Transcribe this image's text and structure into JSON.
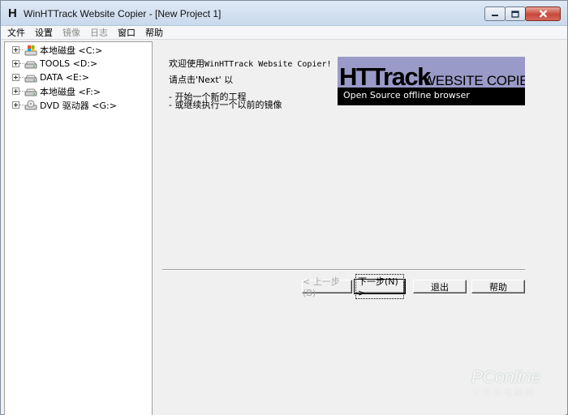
{
  "window": {
    "logo_letter": "H",
    "title": "WinHTTrack Website Copier - [New Project 1]"
  },
  "menubar": {
    "items": [
      {
        "label": "文件",
        "enabled": true
      },
      {
        "label": "设置",
        "enabled": true
      },
      {
        "label": "镜像",
        "enabled": false
      },
      {
        "label": "日志",
        "enabled": false
      },
      {
        "label": "窗口",
        "enabled": true
      },
      {
        "label": "帮助",
        "enabled": true
      }
    ]
  },
  "tree": {
    "items": [
      {
        "label": "本地磁盘 <C:>",
        "icon": "system-drive-icon"
      },
      {
        "label": "TOOLS <D:>",
        "icon": "hard-drive-icon"
      },
      {
        "label": "DATA <E:>",
        "icon": "hard-drive-icon"
      },
      {
        "label": "本地磁盘 <F:>",
        "icon": "hard-drive-icon"
      },
      {
        "label": "DVD 驱动器 <G:>",
        "icon": "dvd-drive-icon"
      }
    ]
  },
  "content": {
    "welcome_prefix": "欢迎使用",
    "welcome_app": "WinHTTrack Website Copier!",
    "prompt": "请点击'Next' 以",
    "option_new": "- 开始一个新的工程",
    "option_continue": "- 或继续执行一个以前的镜像",
    "logo": {
      "big": "HTTrack",
      "small": "WEBSITE COPIER",
      "tagline": "Open Source offline browser",
      "bg_color": "#9a9ac8"
    }
  },
  "buttons": {
    "back": "< 上一步(B)",
    "next": "下一步(N) >",
    "exit": "退出",
    "help": "帮助"
  },
  "watermark": {
    "brand": "PConline",
    "sub": "太平洋电脑网"
  }
}
